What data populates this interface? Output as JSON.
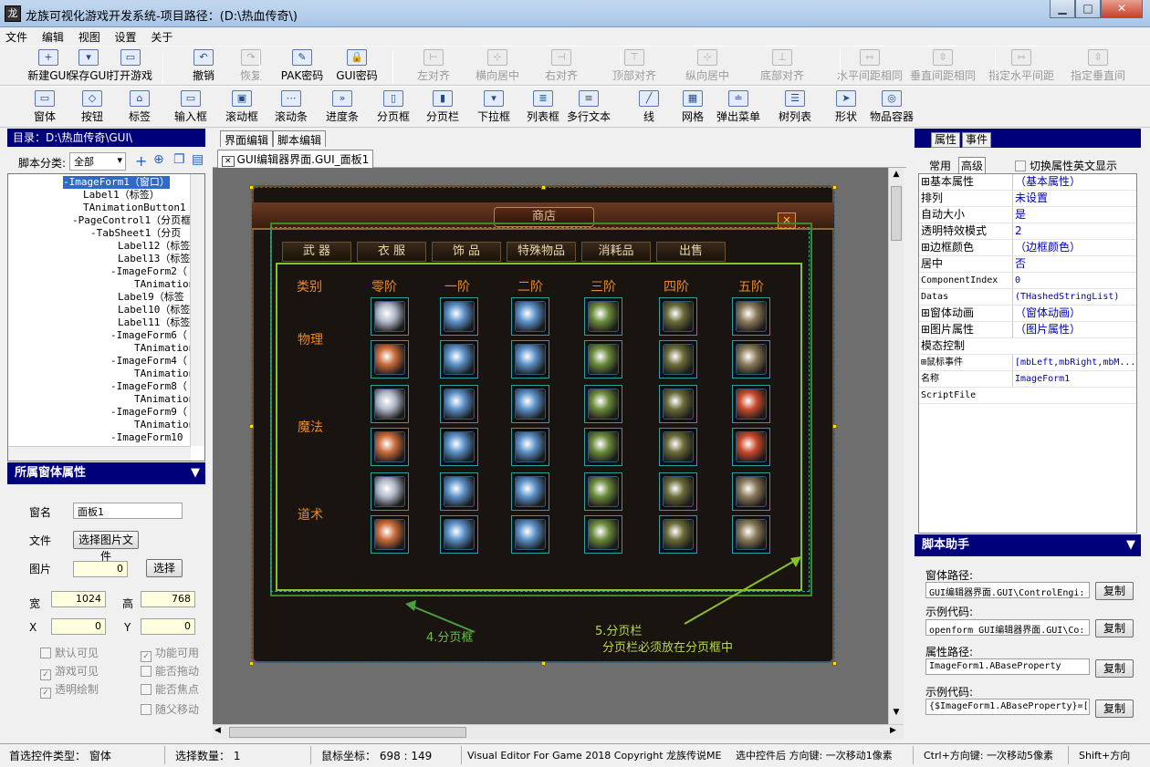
{
  "window": {
    "title": "龙族可视化游戏开发系统-项目路径：(D:\\热血传奇\\)"
  },
  "menu": [
    "文件",
    "编辑",
    "视图",
    "设置",
    "关于"
  ],
  "toolbar1": [
    {
      "label": "新建GUI",
      "icon": "new-file-icon",
      "glyph": "+"
    },
    {
      "label": "保存GUI",
      "icon": "save-icon",
      "glyph": "▾"
    },
    {
      "label": "打开游戏",
      "icon": "open-folder-icon",
      "glyph": "▭"
    },
    {
      "label": "撤销",
      "icon": "undo-icon",
      "glyph": "↶"
    },
    {
      "label": "恢复",
      "icon": "redo-icon",
      "glyph": "↷"
    },
    {
      "label": "PAK密码",
      "icon": "pak-password-icon",
      "glyph": "✎"
    },
    {
      "label": "GUI密码",
      "icon": "lock-icon",
      "glyph": "🔒"
    },
    {
      "label": "左对齐",
      "icon": "align-left-icon",
      "glyph": "⊢"
    },
    {
      "label": "横向居中",
      "icon": "align-hcenter-icon",
      "glyph": "⊹"
    },
    {
      "label": "右对齐",
      "icon": "align-right-icon",
      "glyph": "⊣"
    },
    {
      "label": "顶部对齐",
      "icon": "align-top-icon",
      "glyph": "⊤"
    },
    {
      "label": "纵向居中",
      "icon": "align-vcenter-icon",
      "glyph": "⊹"
    },
    {
      "label": "底部对齐",
      "icon": "align-bottom-icon",
      "glyph": "⊥"
    },
    {
      "label": "水平间距相同",
      "icon": "hspace-equal-icon",
      "glyph": "⇿"
    },
    {
      "label": "垂直间距相同",
      "icon": "vspace-equal-icon",
      "glyph": "⇳"
    },
    {
      "label": "指定水平间距",
      "icon": "set-hspace-icon",
      "glyph": "⇿"
    },
    {
      "label": "指定垂直间",
      "icon": "set-vspace-icon",
      "glyph": "⇳"
    }
  ],
  "toolbar2": [
    {
      "label": "窗体",
      "icon": "window-icon",
      "glyph": "▭"
    },
    {
      "label": "按钮",
      "icon": "button-icon",
      "glyph": "◇"
    },
    {
      "label": "标签",
      "icon": "label-icon",
      "glyph": "⌂"
    },
    {
      "label": "输入框",
      "icon": "input-box-icon",
      "glyph": "▭"
    },
    {
      "label": "滚动框",
      "icon": "scroll-box-icon",
      "glyph": "▣"
    },
    {
      "label": "滚动条",
      "icon": "scrollbar-icon",
      "glyph": "⋯"
    },
    {
      "label": "进度条",
      "icon": "progress-icon",
      "glyph": "»"
    },
    {
      "label": "分页框",
      "icon": "page-control-icon",
      "glyph": "▯"
    },
    {
      "label": "分页栏",
      "icon": "tab-sheet-icon",
      "glyph": "▮"
    },
    {
      "label": "下拉框",
      "icon": "dropdown-icon",
      "glyph": "▾"
    },
    {
      "label": "列表框",
      "icon": "listbox-icon",
      "glyph": "≣"
    },
    {
      "label": "多行文本",
      "icon": "memo-icon",
      "glyph": "≡"
    },
    {
      "label": "线",
      "icon": "line-icon",
      "glyph": "╱"
    },
    {
      "label": "网格",
      "icon": "grid-icon",
      "glyph": "▦"
    },
    {
      "label": "弹出菜单",
      "icon": "popup-menu-icon",
      "glyph": "≐"
    },
    {
      "label": "树列表",
      "icon": "tree-list-icon",
      "glyph": "☰"
    },
    {
      "label": "形状",
      "icon": "shape-icon",
      "glyph": "➤"
    },
    {
      "label": "物品容器",
      "icon": "item-container-icon",
      "glyph": "◎"
    }
  ],
  "left": {
    "dir_label": "目录：D:\\热血传奇\\GUI\\",
    "category_label": "脚本分类:",
    "category_value": "全部",
    "tree": [
      {
        "text": "-ImageForm1（窗口）",
        "indent": 60,
        "sel": true
      },
      {
        "text": "Label1（标签）",
        "indent": 82
      },
      {
        "text": "TAnimationButton1（",
        "indent": 82
      },
      {
        "text": "-PageControl1（分页框",
        "indent": 70
      },
      {
        "text": "-TabSheet1（分页",
        "indent": 90
      },
      {
        "text": "Label12（标签",
        "indent": 120
      },
      {
        "text": "Label13（标签",
        "indent": 120
      },
      {
        "text": "-ImageForm2（",
        "indent": 112
      },
      {
        "text": "TAnimation",
        "indent": 138
      },
      {
        "text": "Label9（标签",
        "indent": 120
      },
      {
        "text": "Label10（标签",
        "indent": 120
      },
      {
        "text": "Label11（标签",
        "indent": 120
      },
      {
        "text": "-ImageForm6（",
        "indent": 112
      },
      {
        "text": "TAnimation",
        "indent": 138
      },
      {
        "text": "-ImageForm4（",
        "indent": 112
      },
      {
        "text": "TAnimation",
        "indent": 138
      },
      {
        "text": "-ImageForm8（",
        "indent": 112
      },
      {
        "text": "TAnimation",
        "indent": 138
      },
      {
        "text": "-ImageForm9（",
        "indent": 112
      },
      {
        "text": "TAnimation",
        "indent": 138
      },
      {
        "text": "-ImageForm10（",
        "indent": 112
      }
    ],
    "form_props_title": "所属窗体属性",
    "name_label": "窗名",
    "name_value": "面板1",
    "file_label": "文件",
    "file_button": "选择图片文件",
    "image_label": "图片",
    "image_value": "0",
    "image_button": "选择",
    "width_label": "宽",
    "width_value": "1024",
    "height_label": "高",
    "height_value": "768",
    "x_label": "X",
    "x_value": "0",
    "y_label": "Y",
    "y_value": "0",
    "checks": [
      {
        "label": "默认可见",
        "checked": false
      },
      {
        "label": "功能可用",
        "checked": true
      },
      {
        "label": "游戏可见",
        "checked": true
      },
      {
        "label": "能否拖动",
        "checked": false
      },
      {
        "label": "透明绘制",
        "checked": true
      },
      {
        "label": "能否焦点",
        "checked": false
      },
      {
        "label": "随父移动",
        "checked": false
      }
    ]
  },
  "center": {
    "tabs": [
      "界面编辑",
      "脚本编辑"
    ],
    "doc_tab": "GUI编辑器界面.GUI_面板1",
    "shop_title": "商店",
    "game_tabs": [
      "武 器",
      "衣 服",
      "饰 品",
      "特殊物品",
      "消耗品",
      "出售"
    ],
    "columns": [
      "类别",
      "零阶",
      "一阶",
      "二阶",
      "三阶",
      "四阶",
      "五阶"
    ],
    "rows": [
      "物理",
      "魔法",
      "道术"
    ],
    "annotation_pagecontrol": "4.分页框",
    "annotation_tabsheet_1": "5.分页栏",
    "annotation_tabsheet_2": "分页栏必须放在分页框中",
    "accent": "#6ac04a"
  },
  "right": {
    "tab_props": "属性",
    "tab_events": "事件",
    "sub_common": "常用",
    "sub_advanced": "高级",
    "toggle_english": "切换属性英文显示",
    "props": [
      {
        "k": "⊞基本属性",
        "v": "（基本属性）"
      },
      {
        "k": "排列",
        "v": "未设置"
      },
      {
        "k": "自动大小",
        "v": "是"
      },
      {
        "k": "透明特效模式",
        "v": "2"
      },
      {
        "k": "⊞边框颜色",
        "v": "（边框颜色）"
      },
      {
        "k": "居中",
        "v": "否"
      },
      {
        "k": "ComponentIndex",
        "v": "0",
        "mono": true
      },
      {
        "k": "Datas",
        "v": "(THashedStringList)",
        "mono": true
      },
      {
        "k": "⊞窗体动画",
        "v": "（窗体动画）"
      },
      {
        "k": "⊞图片属性",
        "v": "（图片属性）"
      },
      {
        "k": "模态控制",
        "v": ""
      },
      {
        "k": "⊞鼠标事件",
        "v": "[mbLeft,mbRight,mbM...",
        "mono": true
      },
      {
        "k": "名称",
        "v": "ImageForm1",
        "mono": true
      },
      {
        "k": "ScriptFile",
        "v": "",
        "mono": true
      }
    ],
    "helper_title": "脚本助手",
    "form_path_label": "窗体路径:",
    "form_path_value": "GUI编辑器界面.GUI\\ControlEngi:",
    "sample1_label": "示例代码:",
    "sample1_value": "openform GUI编辑器界面.GUI\\Co:",
    "prop_path_label": "属性路径:",
    "prop_path_value": "ImageForm1.ABaseProperty",
    "sample2_label": "示例代码:",
    "sample2_value": "{$ImageForm1.ABaseProperty}=[",
    "copy_label": "复制"
  },
  "status": {
    "selected_type": "首选控件类型： 窗体",
    "selected_count": "选择数量： 1",
    "mouse": "鼠标坐标： 698 : 149",
    "copyright": "Visual Editor For Game 2018 Copyright 龙族传说ME",
    "hint1": "选中控件后 方向键: 一次移动1像素",
    "hint2": "Ctrl+方向键: 一次移动5像素",
    "hint3": "Shift+方向"
  }
}
